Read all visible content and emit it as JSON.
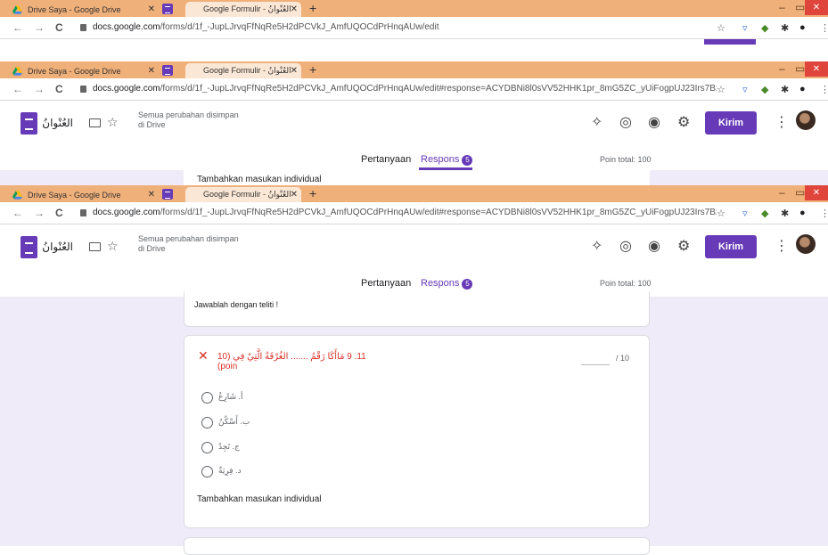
{
  "tabs": {
    "inactive_title": "Drive Saya - Google Drive",
    "active_title": "Google Formulir - العُنْوانُ",
    "close_glyph": "✕",
    "new_tab": "+"
  },
  "window": {
    "minimize": "–",
    "restore": "▭",
    "close": "✕"
  },
  "nav": {
    "back": "←",
    "forward": "→",
    "reload": "C"
  },
  "urls": {
    "first_host": "docs.google.com",
    "first_path": "/forms/d/1f_-JupLJrvqFfNqRe5H2dPCVkJ_AmfUQOCdPrHnqAUw/edit",
    "second_host": "docs.google.com",
    "second_path": "/forms/d/1f_-JupLJrvqFfNqRe5H2dPCVkJ_AmfUQOCdPrHnqAUw/edit#response=ACYDBNi8l0sVV52HHK1pr_8mG5ZC_yUiFogpUJ23Irs7B23CF6qr...",
    "third_host": "docs.google.com",
    "third_path": "/forms/d/1f_-JupLJrvqFfNqRe5H2dPCVkJ_AmfUQOCdPrHnqAUw/edit#response=ACYDBNi8l0sVV52HHK1pr_8mG5ZC_yUiFogpUJ23Irs7B23CF6qr..."
  },
  "form_header": {
    "title": "العُنْوانُ",
    "saved_line1": "Semua perubahan disimpan",
    "saved_line2": "di Drive",
    "send_label": "Kirim"
  },
  "form_tabs": {
    "questions": "Pertanyaan",
    "responses": "Respons",
    "responses_count": "5",
    "points_total": "Poin total: 100"
  },
  "overlap_text": "Tambahkan masukan individual",
  "main": {
    "instruction": "Jawablah dengan teliti !",
    "question": "11. 9 مَاأَكَا رَقْمُ ....... الغُرْفَةُ الَّتِيْ فِي (10 poin)",
    "score_suffix": "/ 10",
    "options": [
      "أ. شَارِعُ",
      "ب. أَسْكُنُ",
      "ج. تَجِدُ",
      "د. فِرِيَةٌ"
    ],
    "add_feedback": "Tambahkan masukan individual"
  },
  "colors": {
    "accent": "#673ab7",
    "tabbar": "#f0b07a",
    "error": "#d93025",
    "bg": "#f0ebf8"
  }
}
